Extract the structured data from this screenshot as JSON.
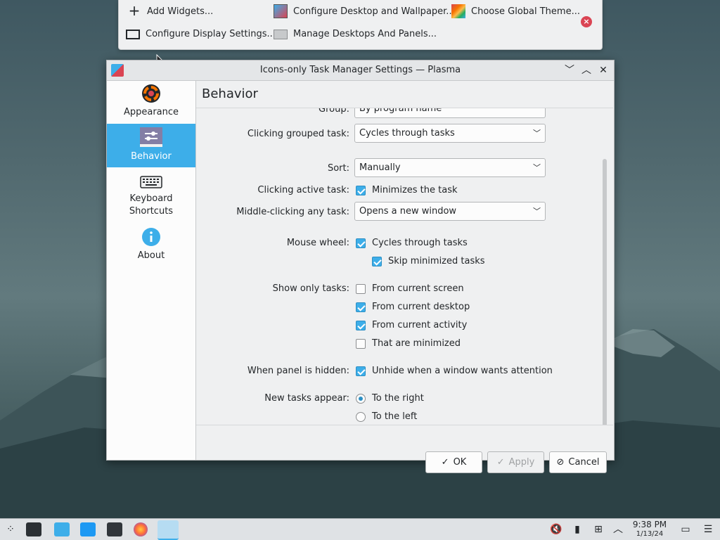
{
  "edit_toolbar": {
    "add_widgets": "Add Widgets...",
    "configure_desktop": "Configure Desktop and Wallpaper...",
    "choose_theme": "Choose Global Theme...",
    "configure_display": "Configure Display Settings...",
    "manage_desktops": "Manage Desktops And Panels..."
  },
  "dialog": {
    "title": "Icons-only Task Manager Settings — Plasma",
    "sidebar": [
      {
        "label": "Appearance"
      },
      {
        "label": "Behavior"
      },
      {
        "label": "Keyboard Shortcuts"
      },
      {
        "label": "About"
      }
    ],
    "page_title": "Behavior",
    "settings": {
      "group_label": "Group:",
      "group_value": "By program name",
      "clicking_grouped_label": "Clicking grouped task:",
      "clicking_grouped_value": "Cycles through tasks",
      "sort_label": "Sort:",
      "sort_value": "Manually",
      "clicking_active_label": "Clicking active task:",
      "clicking_active_check": "Minimizes the task",
      "middle_click_label": "Middle-clicking any task:",
      "middle_click_value": "Opens a new window",
      "mouse_wheel_label": "Mouse wheel:",
      "mouse_wheel_check": "Cycles through tasks",
      "skip_minimized": "Skip minimized tasks",
      "show_only_label": "Show only tasks:",
      "from_screen": "From current screen",
      "from_desktop": "From current desktop",
      "from_activity": "From current activity",
      "that_minimized": "That are minimized",
      "panel_hidden_label": "When panel is hidden:",
      "unhide_check": "Unhide when a window wants attention",
      "new_tasks_label": "New tasks appear:",
      "to_right": "To the right",
      "to_left": "To the left"
    },
    "buttons": {
      "ok": "OK",
      "apply": "Apply",
      "cancel": "Cancel"
    }
  },
  "taskbar": {
    "time": "9:38 PM",
    "date": "1/13/24"
  },
  "colors": {
    "accent": "#3daee9",
    "window_bg": "#eff0f1",
    "close_red": "#da4453"
  }
}
